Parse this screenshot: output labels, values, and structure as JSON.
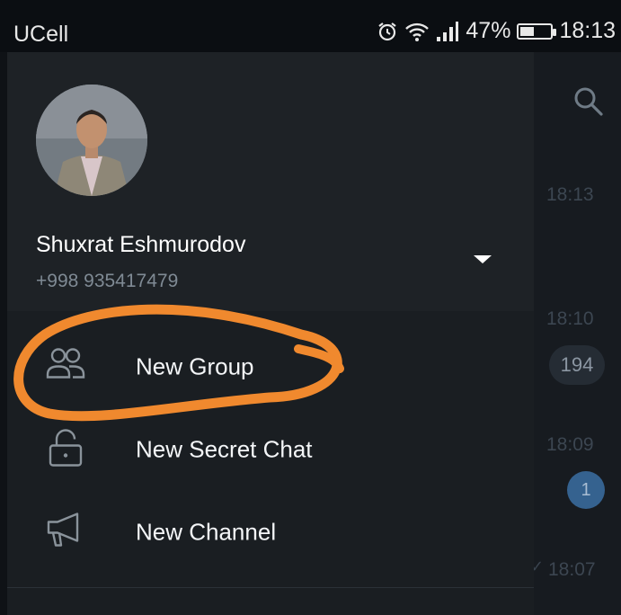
{
  "status_bar": {
    "carrier": "UCell",
    "battery": "47%",
    "battery_level": 0.47,
    "clock": "18:13"
  },
  "chat_list": {
    "times": [
      "18:13",
      "18:10",
      "18:09",
      "18:07"
    ],
    "unread_badges": [
      "194",
      "1"
    ]
  },
  "drawer": {
    "user": {
      "name": "Shuxrat Eshmurodov",
      "phone": "+998 935417479"
    },
    "menu": [
      {
        "label": "New Group",
        "icon": "group-icon"
      },
      {
        "label": "New Secret Chat",
        "icon": "lock-icon"
      },
      {
        "label": "New Channel",
        "icon": "megaphone-icon"
      }
    ]
  },
  "colors": {
    "drawer_bg": "#1a1e22",
    "header_bg": "#1e2226",
    "annotation": "#f0892e",
    "badge_blue": "#35628f"
  }
}
